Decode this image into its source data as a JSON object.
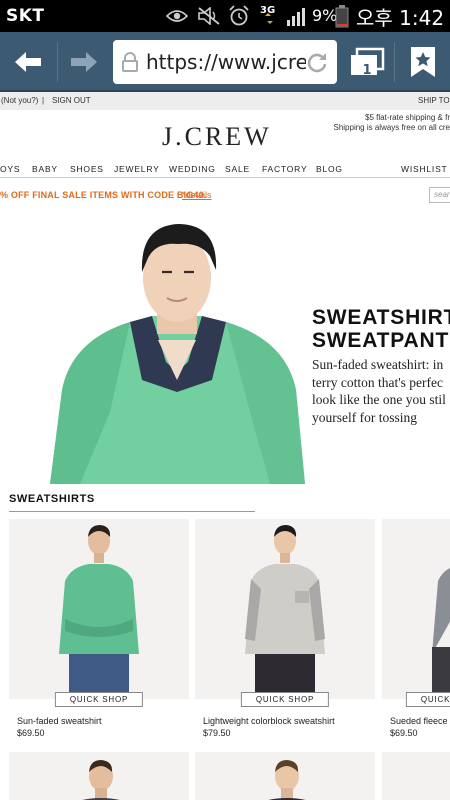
{
  "status_bar": {
    "carrier": "SKT",
    "network": "3G",
    "battery": "9%",
    "time": "오후 1:42",
    "icons": [
      "eye-icon",
      "mute-icon",
      "alarm-icon",
      "network-3g-icon",
      "signal-icon",
      "battery-icon"
    ]
  },
  "browser": {
    "url": "https://www.jcrew",
    "tab_count": "1",
    "icons": [
      "back-arrow-icon",
      "forward-arrow-icon",
      "lock-icon",
      "reload-icon",
      "tabs-icon",
      "bookmark-icon"
    ]
  },
  "page": {
    "utility": {
      "not_you": "(Not you?)",
      "sign_out": "SIGN OUT",
      "ship_to": "SHIP TO:"
    },
    "logo": "J.CREW",
    "shipping": {
      "line1": "$5 flat-rate shipping & fr",
      "line2": "Shipping is always free on all cre"
    },
    "nav": [
      "OYS",
      "BABY",
      "SHOES",
      "JEWELRY",
      "WEDDING",
      "SALE",
      "FACTORY",
      "BLOG",
      "WISHLIST"
    ],
    "promo": {
      "text": "% OFF FINAL SALE ITEMS WITH CODE BIG40.",
      "link": "*details"
    },
    "search_placeholder": "sear",
    "hero": {
      "title_line1": "SWEATSHIRT",
      "title_line2": "SWEATPANT",
      "copy_line1": "Sun-faded sweatshirt: in",
      "copy_line2": "terry cotton that's perfec",
      "copy_line3": "look like the one you stil",
      "copy_line4": "yourself for tossing"
    },
    "section_title": "SWEATSHIRTS",
    "quick_shop_label": "QUICK SHOP",
    "products": [
      {
        "name": "Sun-faded sweatshirt",
        "price": "$69.50",
        "color": "#5fbf92"
      },
      {
        "name": "Lightweight colorblock sweatshirt",
        "price": "$79.50",
        "color": "#c9c7c2"
      },
      {
        "name": "Sueded fleece",
        "price": "$69.50",
        "color": "#8a8f96"
      }
    ]
  },
  "colors": {
    "toolbar": "#3d5a73",
    "promo": "#e06a1c",
    "hero_sweater": "#6fcf9f"
  }
}
